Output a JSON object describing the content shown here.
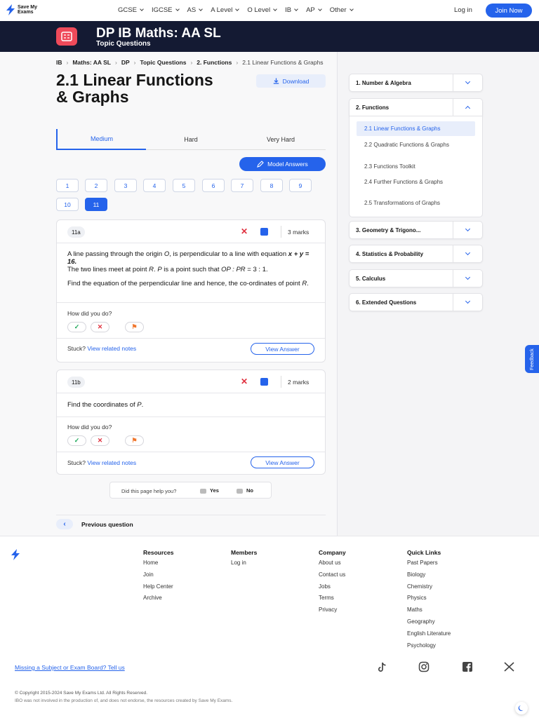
{
  "brand": {
    "name_line1": "Save My",
    "name_line2": "Exams",
    "accent": "#2563eb"
  },
  "nav": {
    "items": [
      "GCSE",
      "IGCSE",
      "AS",
      "A Level",
      "O Level",
      "IB",
      "AP",
      "Other"
    ],
    "login": "Log in",
    "join": "Join Now"
  },
  "hero": {
    "title": "DP IB Maths: AA SL",
    "subtitle": "Topic Questions"
  },
  "breadcrumb": [
    "IB",
    "Maths: AA SL",
    "DP",
    "Topic Questions",
    "2. Functions",
    "2.1 Linear Functions & Graphs"
  ],
  "page": {
    "title": "2.1 Linear Functions & Graphs",
    "download": "Download",
    "tabs": [
      "Medium",
      "Hard",
      "Very Hard"
    ],
    "model_answers": "Model Answers",
    "question_numbers": [
      "1",
      "2",
      "3",
      "4",
      "5",
      "6",
      "7",
      "8",
      "9",
      "10",
      "11"
    ],
    "active_question": "11"
  },
  "questions": [
    {
      "tag": "11a",
      "marks": "3 marks",
      "p1_a": "A line passing through the origin ",
      "p1_b": "O",
      "p1_c": ", is perpendicular to a line with equation ",
      "p1_d": "x + y = 16.",
      "p2_a": "The two lines meet at point ",
      "p2_b": "R",
      "p2_c": ". ",
      "p2_d": "P",
      "p2_e": " is a point such that ",
      "p2_f": "OP : PR",
      "p2_g": " = 3 : 1.",
      "p3_a": "Find the equation of the perpendicular line and hence, the co-ordinates of point ",
      "p3_b": "R",
      "p3_c": ".",
      "how": "How did you do?",
      "stuck": "Stuck?",
      "related": "View related notes",
      "view_answer": "View Answer"
    },
    {
      "tag": "11b",
      "marks": "2 marks",
      "p1_a": "Find the coordinates of ",
      "p1_b": "P",
      "p1_c": ".",
      "how": "How did you do?",
      "stuck": "Stuck?",
      "related": "View related notes",
      "view_answer": "View Answer"
    }
  ],
  "helpful": {
    "question": "Did this page help you?",
    "yes": "Yes",
    "no": "No"
  },
  "previous": "Previous question",
  "sidebar": {
    "sections": [
      "1. Number & Algebra",
      "2. Functions",
      "3. Geometry & Trigono...",
      "4. Statistics & Probability",
      "5. Calculus",
      "6. Extended Questions"
    ],
    "subtopics": [
      "2.1 Linear Functions & Graphs",
      "2.2 Quadratic Functions & Graphs",
      "2.3 Functions Toolkit",
      "2.4 Further Functions & Graphs",
      "2.5 Transformations of Graphs"
    ]
  },
  "feedback": "Feedback",
  "footer": {
    "resources": {
      "title": "Resources",
      "links": [
        "Home",
        "Join",
        "Help Center",
        "Archive"
      ]
    },
    "members": {
      "title": "Members",
      "links": [
        "Log in"
      ]
    },
    "company": {
      "title": "Company",
      "links": [
        "About us",
        "Contact us",
        "Jobs",
        "Terms",
        "Privacy"
      ]
    },
    "quick": {
      "title": "Quick Links",
      "links": [
        "Past Papers",
        "Biology",
        "Chemistry",
        "Physics",
        "Maths",
        "Geography",
        "English Literature",
        "Psychology"
      ]
    },
    "missing": "Missing a Subject or Exam Board? Tell us",
    "socials": [
      "tiktok-icon",
      "instagram-icon",
      "facebook-icon",
      "x-icon"
    ],
    "copyright": "© Copyright 2015-2024 Save My Exams Ltd. All Rights Reserved.",
    "ibo": "IBO was not involved in the production of, and does not endorse, the resources created by Save My Exams."
  }
}
